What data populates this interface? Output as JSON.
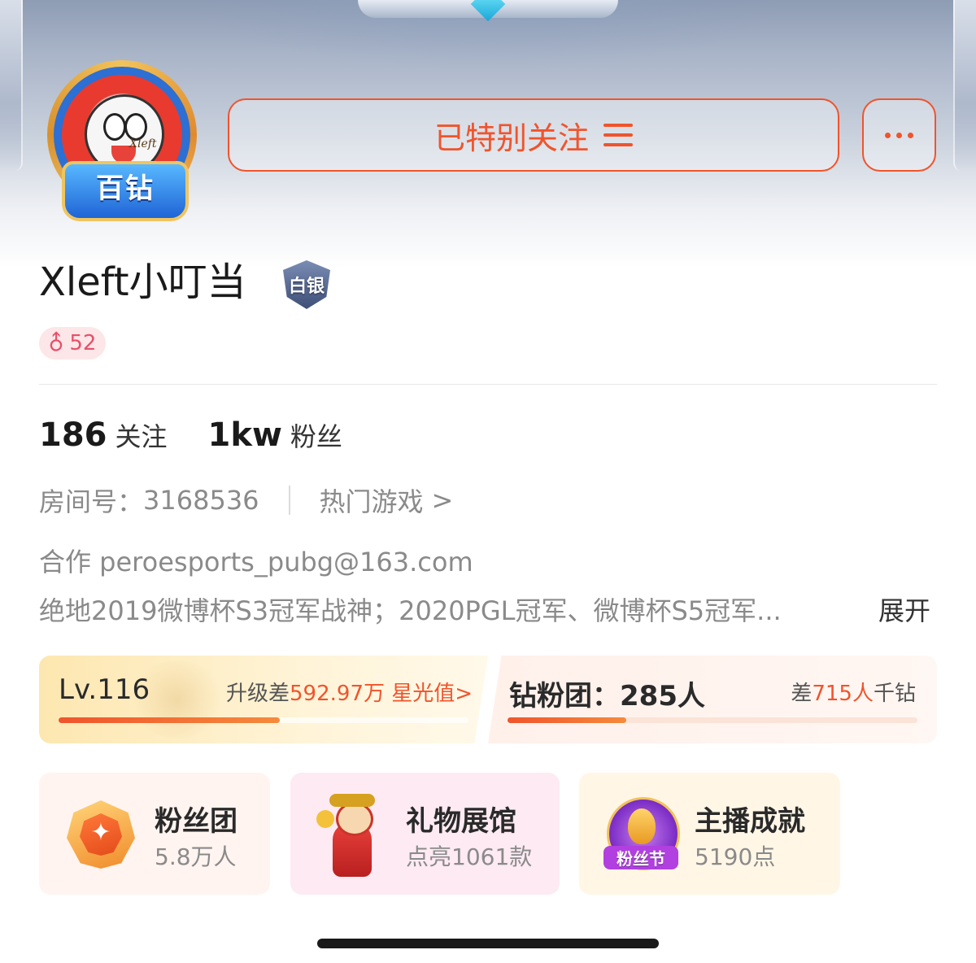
{
  "profile": {
    "avatar_badge": "百钻",
    "avatar_signature": "Xleft",
    "name": "Xleft小叮当",
    "rank_badge": "白银",
    "gender_symbol": "♂",
    "age": "52"
  },
  "actions": {
    "follow_label": "已特别关注",
    "more_icon": "more-dots-icon",
    "menu_icon": "menu-lines-icon",
    "accent_color": "#f0542c"
  },
  "stats": {
    "following_count": "186",
    "following_label": "关注",
    "fans_count": "1kw",
    "fans_label": "粉丝"
  },
  "room": {
    "room_label": "房间号：",
    "room_id": "3168536",
    "hot_games_label": "热门游戏",
    "hot_games_chevron": ">"
  },
  "bio": {
    "line1": "合作 peroesports_pubg@163.com",
    "line2": "绝地2019微博杯S3冠军战神；2020PGL冠军、微博杯S5冠军...",
    "expand_label": "展开"
  },
  "level_card": {
    "level": "Lv.116",
    "upgrade_prefix": "升级差",
    "upgrade_value": "592.97万",
    "upgrade_suffix": " 星光值>",
    "progress": 0.54
  },
  "fan_card": {
    "title": "钻粉团：285人",
    "gap_prefix": "差",
    "gap_value": "715人",
    "gap_suffix": "千钻",
    "progress": 0.29
  },
  "tiles": [
    {
      "title": "粉丝团",
      "subtitle": "5.8万人",
      "icon": "fan-club-star-icon"
    },
    {
      "title": "礼物展馆",
      "subtitle": "点亮1061款",
      "icon": "god-of-wealth-gift-icon"
    },
    {
      "title": "主播成就",
      "subtitle": "5190点",
      "icon": "fan-festival-gourd-icon",
      "icon_label": "粉丝节"
    }
  ]
}
